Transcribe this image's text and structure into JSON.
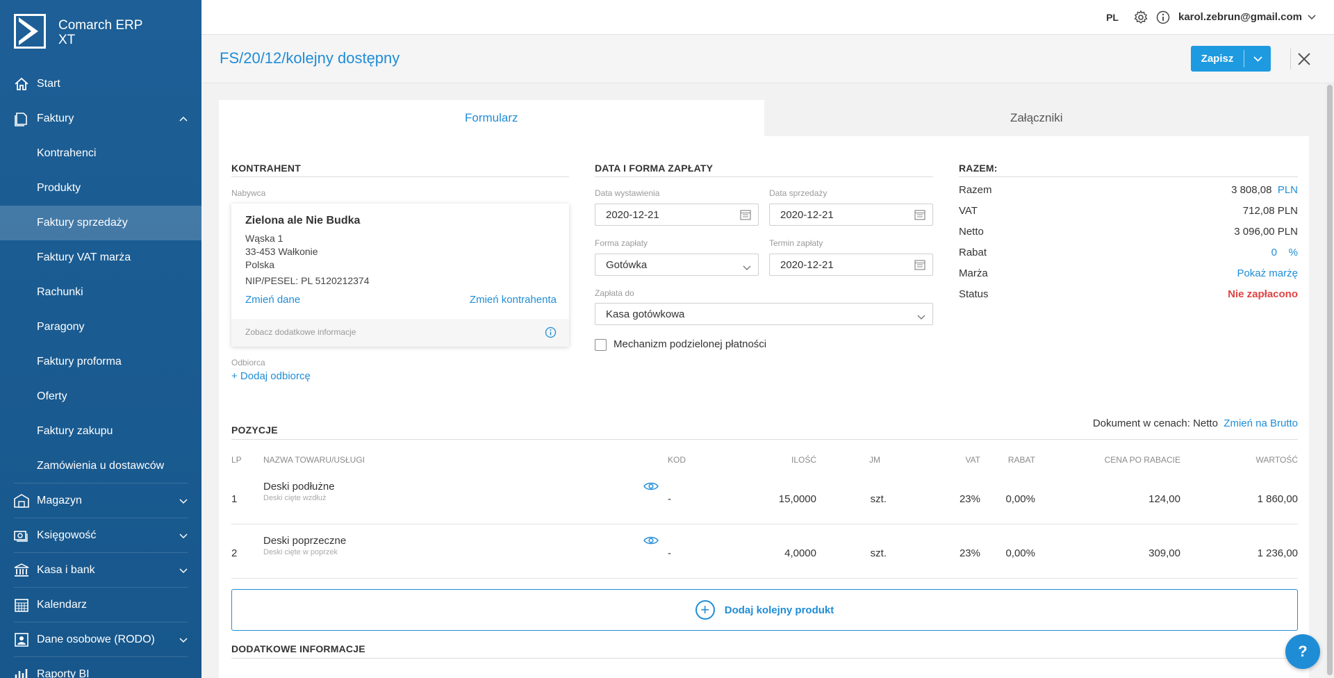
{
  "app": {
    "name": "Comarch ERP XT"
  },
  "sidebar": {
    "items": [
      {
        "label": "Start"
      },
      {
        "label": "Faktury"
      },
      {
        "label": "Kontrahenci"
      },
      {
        "label": "Produkty"
      },
      {
        "label": "Faktury sprzedaży"
      },
      {
        "label": "Faktury VAT marża"
      },
      {
        "label": "Rachunki"
      },
      {
        "label": "Paragony"
      },
      {
        "label": "Faktury proforma"
      },
      {
        "label": "Oferty"
      },
      {
        "label": "Faktury zakupu"
      },
      {
        "label": "Zamówienia u dostawców"
      },
      {
        "label": "Magazyn"
      },
      {
        "label": "Księgowość"
      },
      {
        "label": "Kasa i bank"
      },
      {
        "label": "Kalendarz"
      },
      {
        "label": "Dane osobowe (RODO)"
      },
      {
        "label": "Raporty BI"
      }
    ]
  },
  "topbar": {
    "lang": "PL",
    "user": "karol.zebrun@gmail.com"
  },
  "header": {
    "title": "FS/20/12/kolejny dostępny",
    "save_label": "Zapisz"
  },
  "tabs": [
    {
      "label": "Formularz"
    },
    {
      "label": "Załączniki"
    }
  ],
  "contractor": {
    "section": "KONTRAHENT",
    "buyer_label": "Nabywca",
    "name": "Zielona ale Nie Budka",
    "street": "Wąska 1",
    "city": "33-453 Wałkonie",
    "country": "Polska",
    "nip": "NIP/PESEL: PL 5120212374",
    "change_data": "Zmień dane",
    "change_contractor": "Zmień kontrahenta",
    "more_info": "Zobacz dodatkowe informacje",
    "recipient_label": "Odbiorca",
    "add_recipient": "+ Dodaj odbiorcę"
  },
  "payment": {
    "section": "DATA I FORMA ZAPŁATY",
    "issue_date_label": "Data wystawienia",
    "issue_date": "2020-12-21",
    "sale_date_label": "Data sprzedaży",
    "sale_date": "2020-12-21",
    "method_label": "Forma zapłaty",
    "method": "Gotówka",
    "due_label": "Termin zapłaty",
    "due_date": "2020-12-21",
    "pay_to_label": "Zapłata do",
    "pay_to": "Kasa gotówkowa",
    "split_payment": "Mechanizm podzielonej płatności"
  },
  "summary": {
    "section": "RAZEM:",
    "razem_label": "Razem",
    "razem_value": "3 808,08",
    "razem_currency": "PLN",
    "vat_label": "VAT",
    "vat_value": "712,08 PLN",
    "netto_label": "Netto",
    "netto_value": "3 096,00 PLN",
    "rabat_label": "Rabat",
    "rabat_value": "0",
    "rabat_unit": "%",
    "marza_label": "Marża",
    "marza_link": "Pokaż marżę",
    "status_label": "Status",
    "status_value": "Nie zapłacono"
  },
  "positions": {
    "section": "POZYCJE",
    "price_mode": "Dokument w cenach: Netto",
    "change_mode": "Zmień na Brutto",
    "columns": {
      "lp": "LP",
      "name": "NAZWA TOWARU/USŁUGI",
      "code": "KOD",
      "qty": "ILOŚĆ",
      "unit": "JM",
      "vat": "VAT",
      "discount": "RABAT",
      "price": "CENA PO RABACIE",
      "value": "WARTOŚĆ"
    },
    "rows": [
      {
        "lp": "1",
        "name": "Deski podłużne",
        "desc": "Deski cięte wzdłuż",
        "code": "-",
        "qty": "15,0000",
        "unit": "szt.",
        "vat": "23%",
        "discount": "0,00%",
        "price": "124,00",
        "value": "1 860,00"
      },
      {
        "lp": "2",
        "name": "Deski poprzeczne",
        "desc": "Deski cięte w poprzek",
        "code": "-",
        "qty": "4,0000",
        "unit": "szt.",
        "vat": "23%",
        "discount": "0,00%",
        "price": "309,00",
        "value": "1 236,00"
      }
    ],
    "add_product": "Dodaj kolejny produkt"
  },
  "additional": {
    "section": "DODATKOWE INFORMACJE"
  },
  "help": {
    "label": "?"
  },
  "colors": {
    "sidebar": "#1d5f96",
    "accent": "#1f8dd6",
    "status_unpaid": "#e04343"
  }
}
